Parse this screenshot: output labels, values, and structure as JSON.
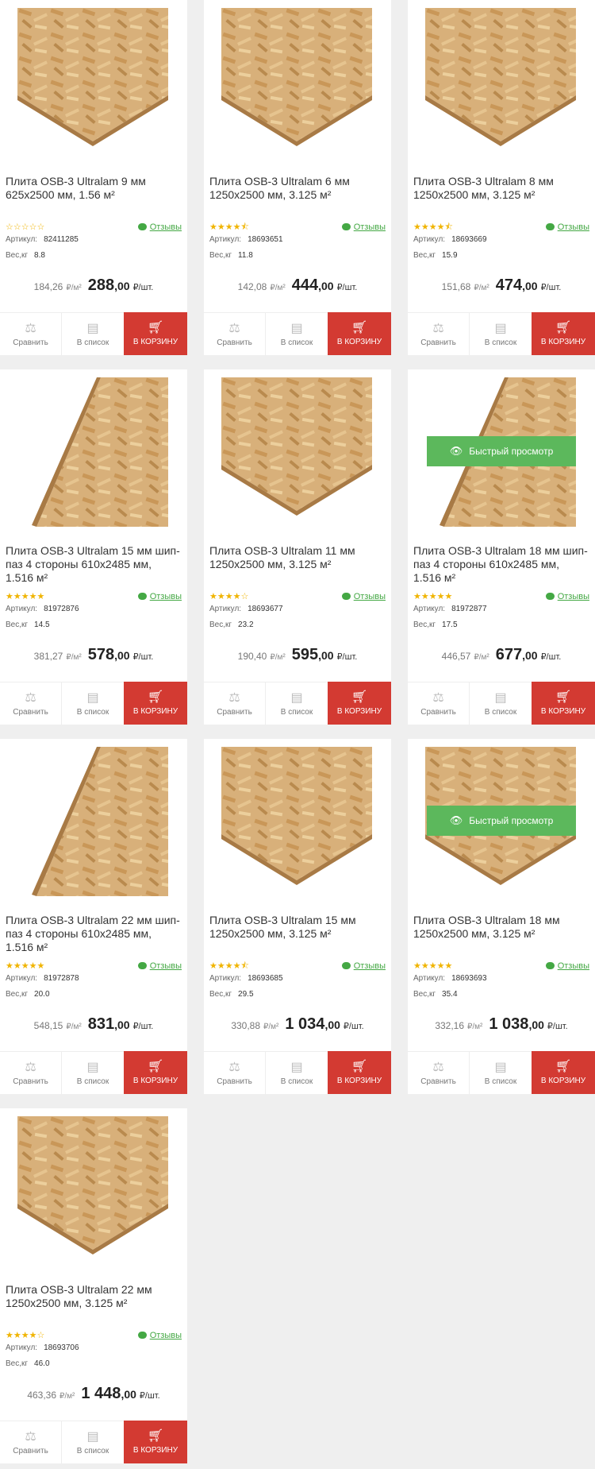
{
  "actions": {
    "compare": "Сравнить",
    "wishlist": "В список",
    "cart": "В КОРЗИНУ"
  },
  "labels": {
    "article": "Артикул:",
    "weight": "Вес,кг",
    "reviews": "Отзывы",
    "ppm_unit": "₽/м²",
    "unit": "₽/шт.",
    "quick_view": "Быстрый просмотр"
  },
  "colors": {
    "cart": "#d33a32",
    "reviews": "#44a844",
    "quick_view": "#5cb85c",
    "stars": "#f0b400"
  },
  "products": [
    {
      "title": "Плита OSB-3 Ultralam 9 мм 625x2500 мм, 1.56 м²",
      "rating": 0,
      "article": "82411285",
      "weight": "8.8",
      "ppm": "184,26",
      "price_main": "288",
      "price_cents": ",00",
      "image": "panel-flat",
      "quick_view": false
    },
    {
      "title": "Плита OSB-3 Ultralam 6 мм 1250x2500 мм, 3.125 м²",
      "rating": 4.5,
      "article": "18693651",
      "weight": "11.8",
      "ppm": "142,08",
      "price_main": "444",
      "price_cents": ",00",
      "image": "panel-flat",
      "quick_view": false
    },
    {
      "title": "Плита OSB-3 Ultralam 8 мм 1250x2500 мм, 3.125 м²",
      "rating": 4.5,
      "article": "18693669",
      "weight": "15.9",
      "ppm": "151,68",
      "price_main": "474",
      "price_cents": ",00",
      "image": "panel-flat",
      "quick_view": false
    },
    {
      "title": "Плита OSB-3 Ultralam 15 мм шип-паз 4 стороны 610x2485 мм, 1.516 м²",
      "rating": 5,
      "article": "81972876",
      "weight": "14.5",
      "ppm": "381,27",
      "price_main": "578",
      "price_cents": ",00",
      "image": "panel-angled",
      "quick_view": false
    },
    {
      "title": "Плита OSB-3 Ultralam 11 мм 1250x2500 мм, 3.125 м²",
      "rating": 4,
      "article": "18693677",
      "weight": "23.2",
      "ppm": "190,40",
      "price_main": "595",
      "price_cents": ",00",
      "image": "panel-flat",
      "quick_view": false
    },
    {
      "title": "Плита OSB-3 Ultralam 18 мм шип-паз 4 стороны 610x2485 мм, 1.516 м²",
      "rating": 5,
      "article": "81972877",
      "weight": "17.5",
      "ppm": "446,57",
      "price_main": "677",
      "price_cents": ",00",
      "image": "panel-angled",
      "quick_view": true
    },
    {
      "title": "Плита OSB-3 Ultralam 22 мм шип-паз 4 стороны 610x2485 мм, 1.516 м²",
      "rating": 5,
      "article": "81972878",
      "weight": "20.0",
      "ppm": "548,15",
      "price_main": "831",
      "price_cents": ",00",
      "image": "panel-angled",
      "quick_view": false
    },
    {
      "title": "Плита OSB-3 Ultralam 15 мм 1250x2500 мм, 3.125 м²",
      "rating": 4.5,
      "article": "18693685",
      "weight": "29.5",
      "ppm": "330,88",
      "price_main": "1 034",
      "price_cents": ",00",
      "image": "panel-flat",
      "quick_view": false
    },
    {
      "title": "Плита OSB-3 Ultralam 18 мм 1250x2500 мм, 3.125 м²",
      "rating": 5,
      "article": "18693693",
      "weight": "35.4",
      "ppm": "332,16",
      "price_main": "1 038",
      "price_cents": ",00",
      "image": "panel-flat",
      "quick_view": true
    },
    {
      "title": "Плита OSB-3 Ultralam 22 мм 1250x2500 мм, 3.125 м²",
      "rating": 4,
      "article": "18693706",
      "weight": "46.0",
      "ppm": "463,36",
      "price_main": "1 448",
      "price_cents": ",00",
      "image": "panel-flat",
      "quick_view": false
    }
  ]
}
